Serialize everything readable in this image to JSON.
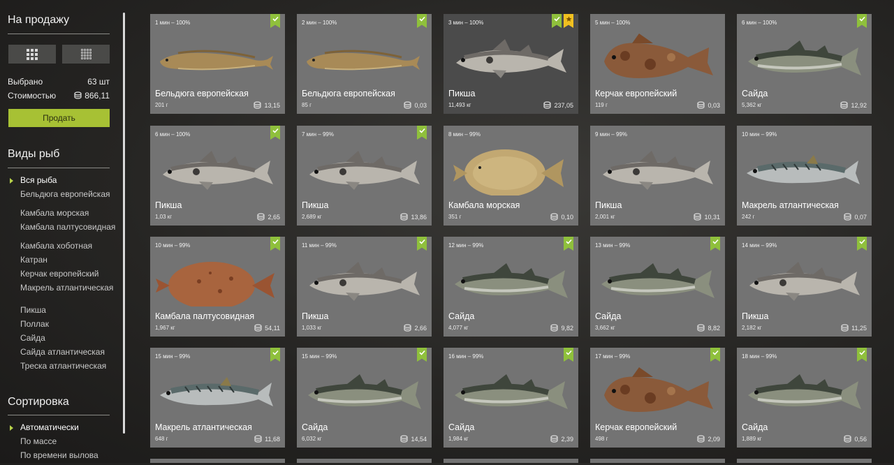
{
  "sidebar": {
    "for_sale_title": "На продажу",
    "selected_label": "Выбрано",
    "selected_value": "63 шт",
    "cost_label": "Стоимостью",
    "cost_value": "866,11",
    "sell_label": "Продать",
    "species_title": "Виды рыб",
    "species": [
      "Вся рыба",
      "Бельдюга европейская",
      "Камбала морская",
      "Камбала палтусовидная",
      "Камбала хоботная",
      "Катран",
      "Керчак европейский",
      "Макрель атлантическая",
      "Пикша",
      "Поллак",
      "Сайда",
      "Сайда атлантическая",
      "Треска атлантическая"
    ],
    "sort_title": "Сортировка",
    "sort_options": [
      "Автоматически",
      "По массе",
      "По времени вылова"
    ]
  },
  "icons": {
    "view_large": "grid-large-icon",
    "view_small": "grid-small-icon",
    "coin": "silver-coin-icon",
    "check": "check-ribbon-icon",
    "star": "star-ribbon-icon"
  },
  "colors": {
    "accent": "#a7c134",
    "badge": "#8fc03c",
    "star": "#f0c020",
    "card": "#737373"
  },
  "cards": [
    {
      "time": "1 мин – 100%",
      "name": "Бельдюга европейская",
      "weight": "201 г",
      "price": "13,15",
      "fish": "eelpout",
      "check": true,
      "star": false,
      "dark": false
    },
    {
      "time": "2 мин – 100%",
      "name": "Бельдюга европейская",
      "weight": "85 г",
      "price": "0,03",
      "fish": "eelpout",
      "check": true,
      "star": false,
      "dark": false
    },
    {
      "time": "3 мин – 100%",
      "name": "Пикша",
      "weight": "11,493 кг",
      "price": "237,05",
      "fish": "haddock",
      "check": true,
      "star": true,
      "dark": true
    },
    {
      "time": "5 мин – 100%",
      "name": "Керчак европейский",
      "weight": "119 г",
      "price": "0,03",
      "fish": "sculpin",
      "check": false,
      "star": false,
      "dark": false
    },
    {
      "time": "6 мин – 100%",
      "name": "Сайда",
      "weight": "5,362 кг",
      "price": "12,92",
      "fish": "saithe",
      "check": true,
      "star": false,
      "dark": false
    },
    {
      "time": "6 мин – 100%",
      "name": "Пикша",
      "weight": "1,03 кг",
      "price": "2,65",
      "fish": "haddock",
      "check": true,
      "star": false,
      "dark": false
    },
    {
      "time": "7 мин – 99%",
      "name": "Пикша",
      "weight": "2,689 кг",
      "price": "13,86",
      "fish": "haddock",
      "check": true,
      "star": false,
      "dark": false
    },
    {
      "time": "8 мин – 99%",
      "name": "Камбала морская",
      "weight": "351 г",
      "price": "0,10",
      "fish": "plaice",
      "check": false,
      "star": false,
      "dark": false
    },
    {
      "time": "9 мин – 99%",
      "name": "Пикша",
      "weight": "2,001 кг",
      "price": "10,31",
      "fish": "haddock",
      "check": false,
      "star": false,
      "dark": false
    },
    {
      "time": "10 мин – 99%",
      "name": "Макрель атлантическая",
      "weight": "242 г",
      "price": "0,07",
      "fish": "mackerel",
      "check": false,
      "star": false,
      "dark": false
    },
    {
      "time": "10 мин – 99%",
      "name": "Камбала палтусовидная",
      "weight": "1,967 кг",
      "price": "54,11",
      "fish": "dab",
      "check": true,
      "star": false,
      "dark": false
    },
    {
      "time": "11 мин – 99%",
      "name": "Пикша",
      "weight": "1,033 кг",
      "price": "2,66",
      "fish": "haddock",
      "check": true,
      "star": false,
      "dark": false
    },
    {
      "time": "12 мин – 99%",
      "name": "Сайда",
      "weight": "4,077 кг",
      "price": "9,82",
      "fish": "saithe",
      "check": true,
      "star": false,
      "dark": false
    },
    {
      "time": "13 мин – 99%",
      "name": "Сайда",
      "weight": "3,662 кг",
      "price": "8,82",
      "fish": "saithe",
      "check": true,
      "star": false,
      "dark": false
    },
    {
      "time": "14 мин – 99%",
      "name": "Пикша",
      "weight": "2,182 кг",
      "price": "11,25",
      "fish": "haddock",
      "check": true,
      "star": false,
      "dark": false
    },
    {
      "time": "15 мин – 99%",
      "name": "Макрель атлантическая",
      "weight": "648 г",
      "price": "11,68",
      "fish": "mackerel",
      "check": true,
      "star": false,
      "dark": false
    },
    {
      "time": "15 мин – 99%",
      "name": "Сайда",
      "weight": "6,032 кг",
      "price": "14,54",
      "fish": "saithe",
      "check": true,
      "star": false,
      "dark": false
    },
    {
      "time": "16 мин – 99%",
      "name": "Сайда",
      "weight": "1,984 кг",
      "price": "2,39",
      "fish": "saithe",
      "check": true,
      "star": false,
      "dark": false
    },
    {
      "time": "17 мин – 99%",
      "name": "Керчак европейский",
      "weight": "498 г",
      "price": "2,09",
      "fish": "sculpin",
      "check": true,
      "star": false,
      "dark": false
    },
    {
      "time": "18 мин – 99%",
      "name": "Сайда",
      "weight": "1,889 кг",
      "price": "0,56",
      "fish": "saithe",
      "check": true,
      "star": false,
      "dark": false
    }
  ]
}
